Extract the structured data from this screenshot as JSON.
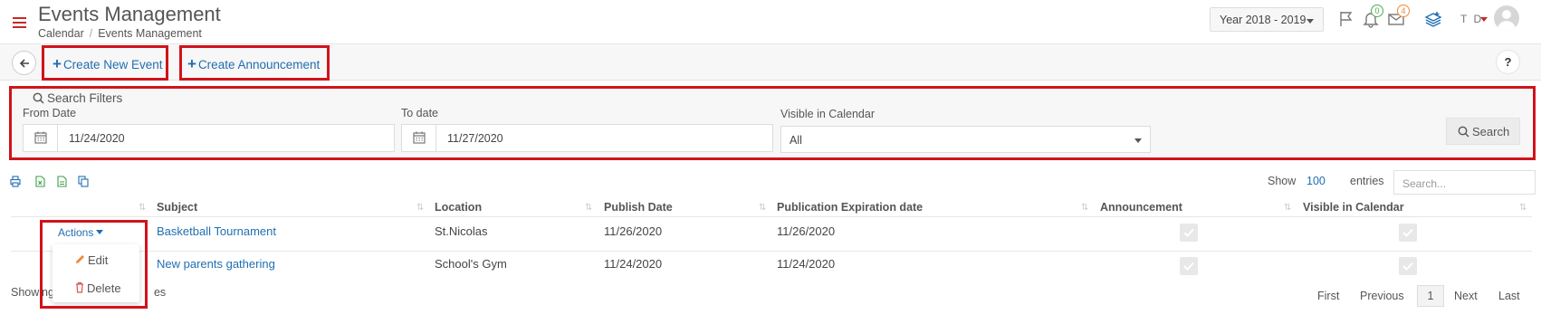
{
  "header": {
    "page_title": "Events Management",
    "breadcrumb": [
      "Calendar",
      "Events Management"
    ],
    "year_selector": "Year 2018 - 2019",
    "notifications_count": "0",
    "messages_count": "4",
    "user_initials": "T D"
  },
  "toolbar": {
    "create_event": "Create New Event",
    "create_announcement": "Create Announcement",
    "help": "?"
  },
  "filters": {
    "title": "Search Filters",
    "from_label": "From Date",
    "from_value": "11/24/2020",
    "to_label": "To date",
    "to_value": "11/27/2020",
    "visible_label": "Visible in Calendar",
    "visible_value": "All",
    "search_button": "Search"
  },
  "table_tools": {
    "show_label": "Show",
    "show_value": "100",
    "entries_label": "entries",
    "search_placeholder": "Search..."
  },
  "table": {
    "columns": [
      "Subject",
      "Location",
      "Publish Date",
      "Publication Expiration date",
      "Announcement",
      "Visible in Calendar"
    ],
    "rows": [
      {
        "subject": "Basketball Tournament",
        "location": "St.Nicolas",
        "publish": "11/26/2020",
        "expiration": "11/26/2020",
        "announcement": true,
        "visible": true
      },
      {
        "subject": "New parents gathering",
        "location": "School's Gym",
        "publish": "11/24/2020",
        "expiration": "11/24/2020",
        "announcement": true,
        "visible": true
      }
    ],
    "actions_label": "Actions",
    "actions_menu": [
      "Edit",
      "Delete"
    ]
  },
  "footer": {
    "info_start": "Showing",
    "info_end": "es",
    "pager": [
      "First",
      "Previous",
      "1",
      "Next",
      "Last"
    ]
  },
  "colors": {
    "accent": "#1f6fb2",
    "highlight": "#d0131b",
    "brand_red": "#c62828"
  }
}
